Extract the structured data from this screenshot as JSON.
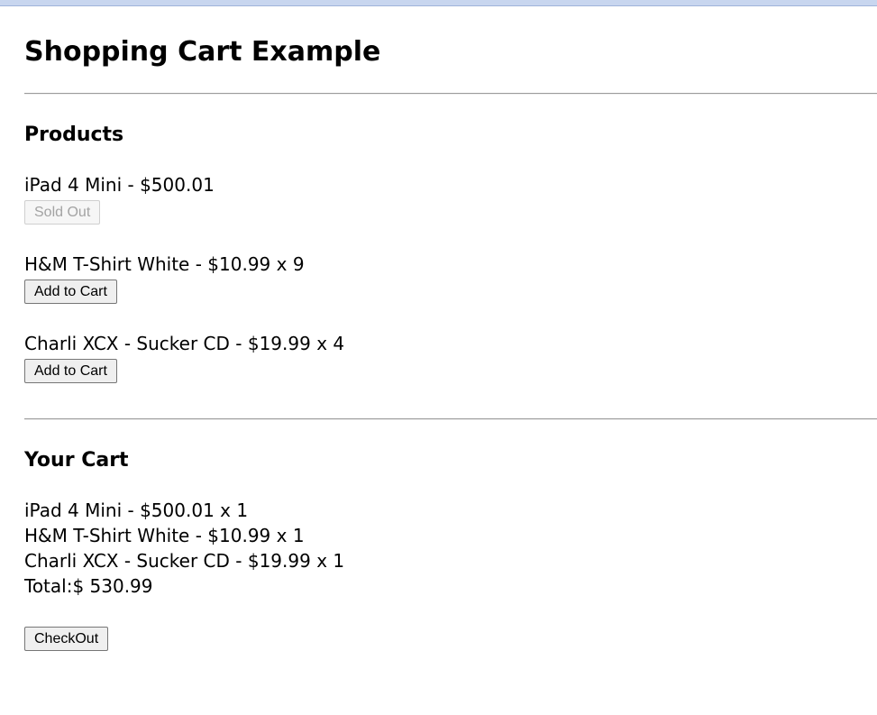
{
  "page": {
    "title": "Shopping Cart Example"
  },
  "products": {
    "heading": "Products",
    "items": [
      {
        "text": "iPad 4 Mini - $500.01",
        "button_label": "Sold Out",
        "button_enabled": false
      },
      {
        "text": "H&M T-Shirt White - $10.99 x 9",
        "button_label": "Add to Cart",
        "button_enabled": true
      },
      {
        "text": "Charli XCX - Sucker CD - $19.99 x 4",
        "button_label": "Add to Cart",
        "button_enabled": true
      }
    ]
  },
  "cart": {
    "heading": "Your Cart",
    "items": [
      "iPad 4 Mini - $500.01 x 1",
      "H&M T-Shirt White - $10.99 x 1",
      "Charli XCX - Sucker CD - $19.99 x 1"
    ],
    "total": "Total:$ 530.99",
    "checkout_label": "CheckOut"
  },
  "colors": {
    "top_strip": "#c8d6ef",
    "button_background": "#efefef",
    "disabled_button_text": "#a3a3a3"
  }
}
